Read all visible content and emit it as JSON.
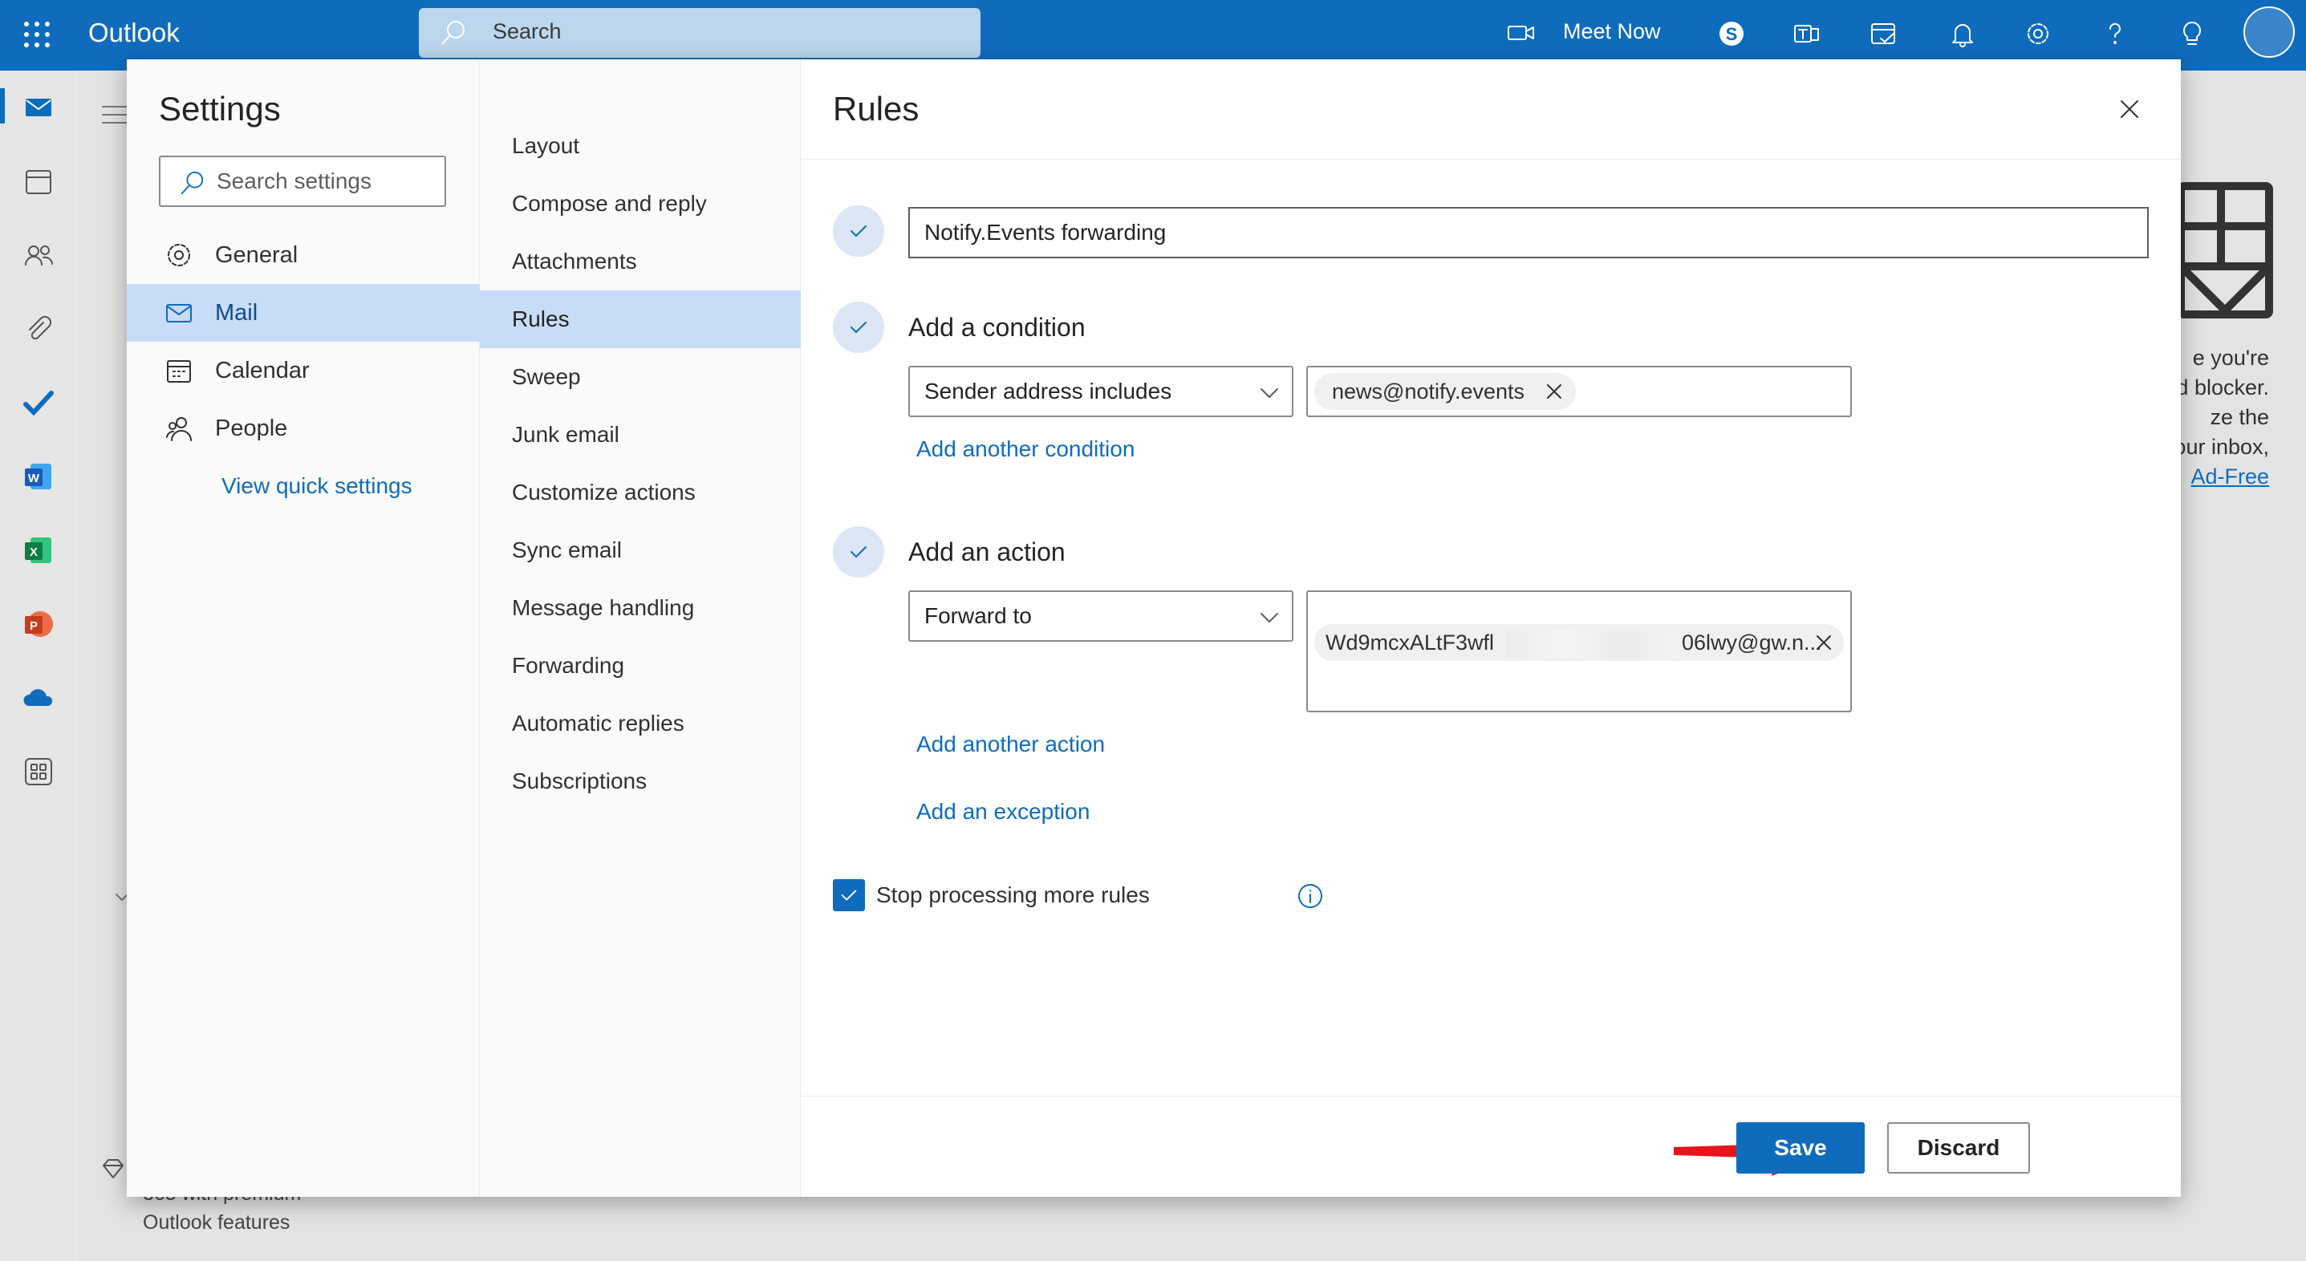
{
  "app": {
    "title": "Outlook"
  },
  "topbar": {
    "search_placeholder": "Search",
    "meet_now": "Meet Now",
    "icons": [
      "app-launcher-icon",
      "search-icon",
      "video-icon",
      "skype-icon",
      "teams-icon",
      "calendar-check-icon",
      "bell-icon",
      "gear-icon",
      "help-icon",
      "lightbulb-icon",
      "avatar"
    ]
  },
  "left_rail": {
    "icons": [
      "mail-icon",
      "calendar-icon",
      "people-icon",
      "attachment-icon",
      "todo-icon",
      "word-icon",
      "excel-icon",
      "powerpoint-icon",
      "onedrive-icon",
      "more-apps-icon"
    ]
  },
  "background": {
    "ad_lines": [
      "e you're",
      "d blocker.",
      "ze the",
      "our inbox,"
    ],
    "ad_link": "Ad-Free",
    "bottom_lines": [
      "365 with premium",
      "Outlook features"
    ]
  },
  "settings": {
    "title": "Settings",
    "search_placeholder": "Search settings",
    "nav": [
      {
        "label": "General",
        "icon": "gear-icon"
      },
      {
        "label": "Mail",
        "icon": "mail-icon",
        "selected": true
      },
      {
        "label": "Calendar",
        "icon": "calendar-icon"
      },
      {
        "label": "People",
        "icon": "people-icon"
      }
    ],
    "view_quick_settings": "View quick settings",
    "mail_nav": [
      {
        "label": "Layout"
      },
      {
        "label": "Compose and reply"
      },
      {
        "label": "Attachments"
      },
      {
        "label": "Rules",
        "selected": true
      },
      {
        "label": "Sweep"
      },
      {
        "label": "Junk email"
      },
      {
        "label": "Customize actions"
      },
      {
        "label": "Sync email"
      },
      {
        "label": "Message handling"
      },
      {
        "label": "Forwarding"
      },
      {
        "label": "Automatic replies"
      },
      {
        "label": "Subscriptions"
      }
    ]
  },
  "rules": {
    "title": "Rules",
    "rule_name": "Notify.Events forwarding",
    "condition": {
      "heading": "Add a condition",
      "type": "Sender address includes",
      "value": "news@notify.events",
      "add_link": "Add another condition"
    },
    "action": {
      "heading": "Add an action",
      "type": "Forward to",
      "recipient_start": "Wd9mcxALtF3wfl",
      "recipient_end": "06lwy@gw.n...",
      "add_link": "Add another action"
    },
    "exception_link": "Add an exception",
    "stop_processing": {
      "label": "Stop processing more rules",
      "checked": true
    },
    "buttons": {
      "save": "Save",
      "discard": "Discard"
    },
    "colors": {
      "accent": "#0f6cbd",
      "selected_bg": "#c7dcf6",
      "arrow": "#e8141b"
    }
  }
}
